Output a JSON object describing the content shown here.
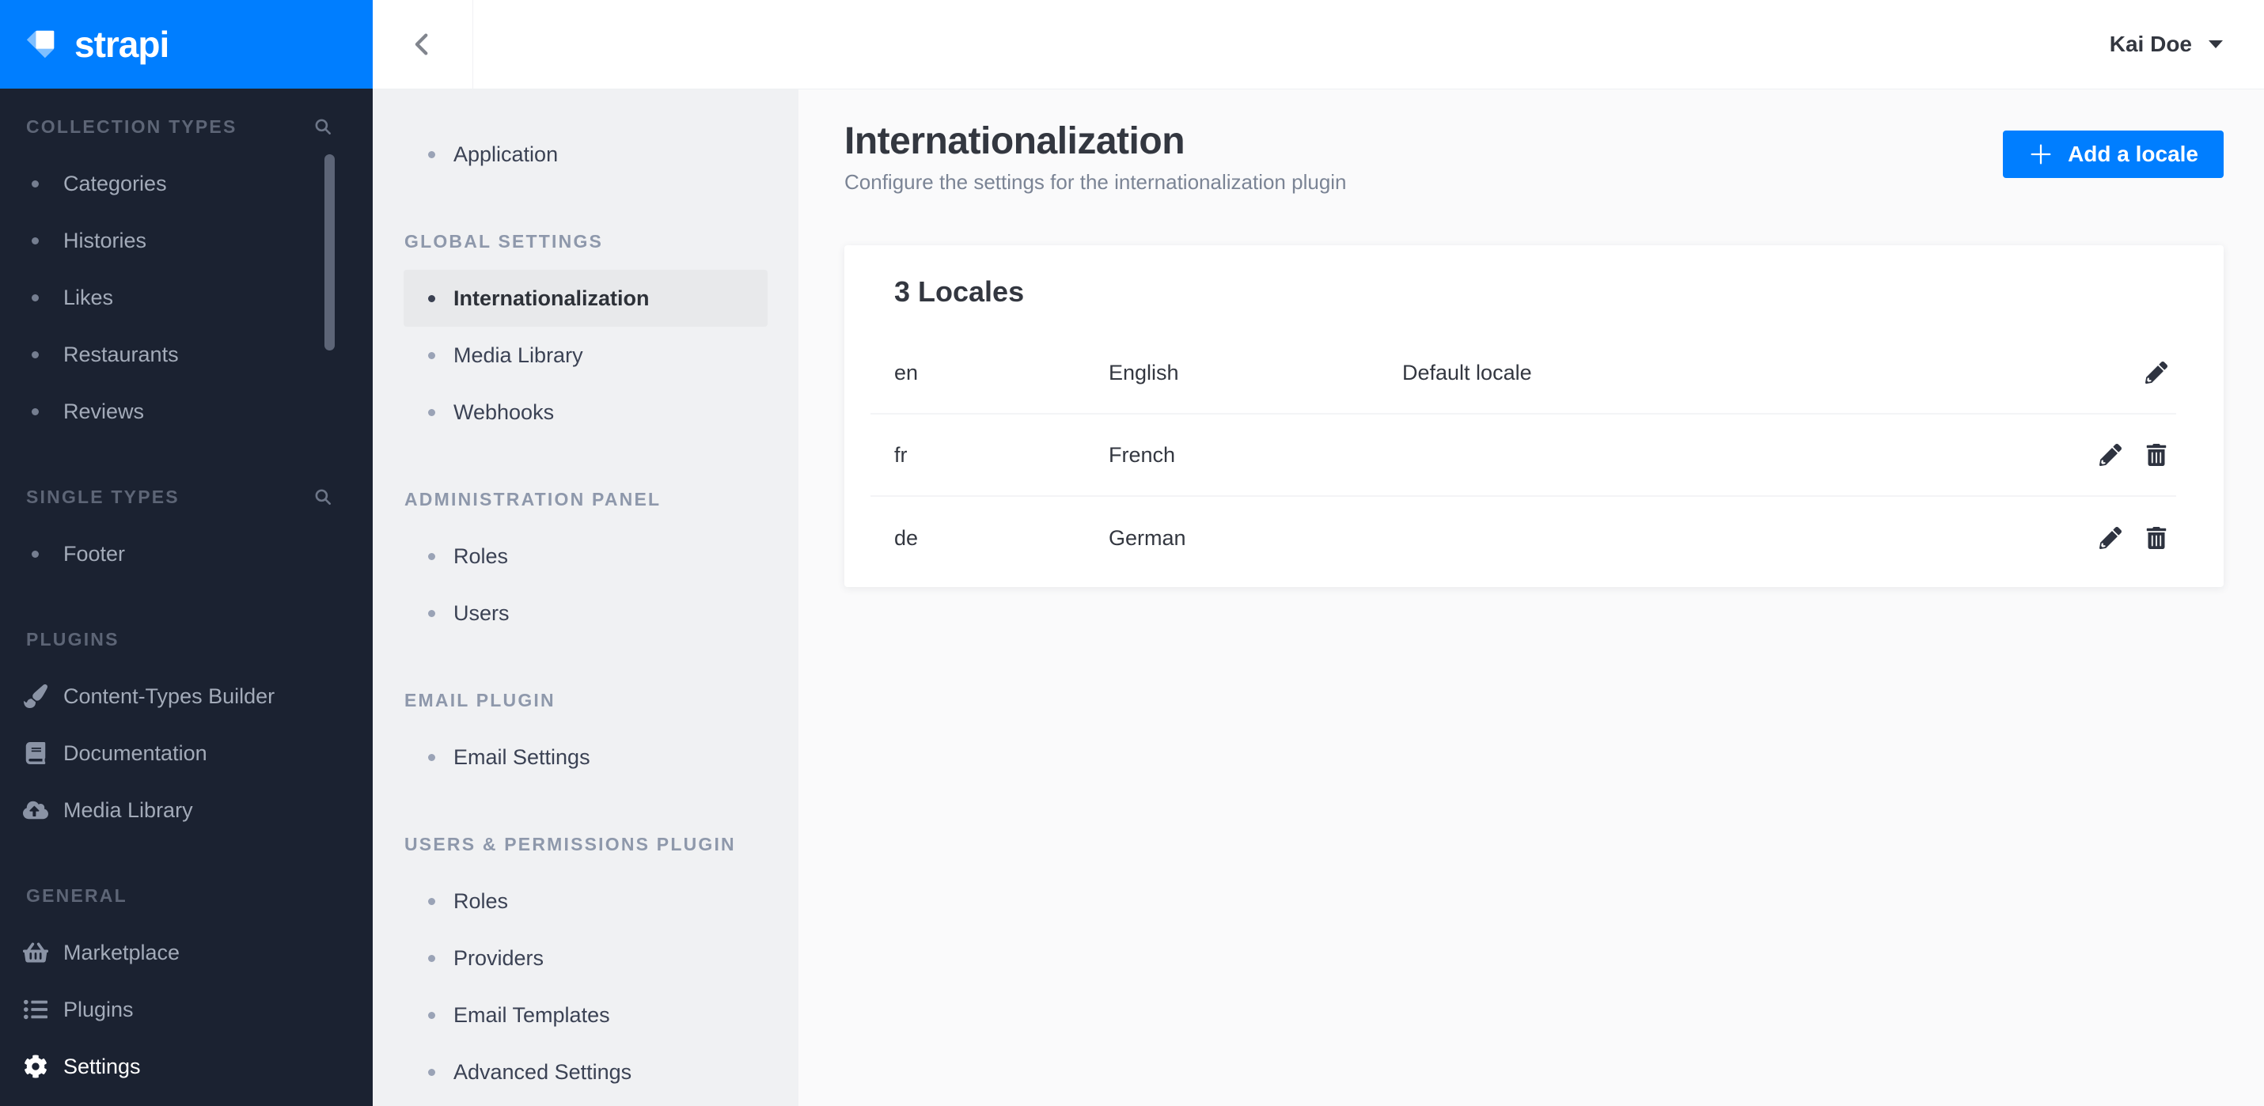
{
  "brand": {
    "name": "strapi"
  },
  "colors": {
    "accent_blue": "#007eff",
    "dark_sidebar_bg": "#1b2231",
    "sub_sidebar_bg": "#f0f1f3",
    "active_item_bg": "#e8e9eb",
    "main_bg": "#fafafb",
    "text_dark": "#333740",
    "text_muted": "#7b8495"
  },
  "topbar": {
    "user_name": "Kai Doe"
  },
  "dark_sidebar": {
    "sections": [
      {
        "label": "COLLECTION TYPES",
        "has_search": true,
        "items": [
          {
            "label": "Categories"
          },
          {
            "label": "Histories"
          },
          {
            "label": "Likes"
          },
          {
            "label": "Restaurants"
          },
          {
            "label": "Reviews"
          }
        ]
      },
      {
        "label": "SINGLE TYPES",
        "has_search": true,
        "items": [
          {
            "label": "Footer"
          }
        ]
      },
      {
        "label": "PLUGINS",
        "items": [
          {
            "label": "Content-Types Builder",
            "icon": "paintbrush-icon"
          },
          {
            "label": "Documentation",
            "icon": "book-icon"
          },
          {
            "label": "Media Library",
            "icon": "cloud-upload-icon"
          }
        ]
      },
      {
        "label": "GENERAL",
        "items": [
          {
            "label": "Marketplace",
            "icon": "basket-icon"
          },
          {
            "label": "Plugins",
            "icon": "list-icon"
          },
          {
            "label": "Settings",
            "icon": "gear-icon",
            "active": true
          }
        ]
      }
    ]
  },
  "settings_sidebar": {
    "top_items": [
      {
        "label": "Application"
      }
    ],
    "sections": [
      {
        "label": "GLOBAL SETTINGS",
        "items": [
          {
            "label": "Internationalization",
            "active": true
          },
          {
            "label": "Media Library"
          },
          {
            "label": "Webhooks"
          }
        ]
      },
      {
        "label": "ADMINISTRATION PANEL",
        "items": [
          {
            "label": "Roles"
          },
          {
            "label": "Users"
          }
        ]
      },
      {
        "label": "EMAIL PLUGIN",
        "items": [
          {
            "label": "Email Settings"
          }
        ]
      },
      {
        "label": "USERS & PERMISSIONS PLUGIN",
        "items": [
          {
            "label": "Roles"
          },
          {
            "label": "Providers"
          },
          {
            "label": "Email Templates"
          },
          {
            "label": "Advanced Settings"
          }
        ]
      }
    ]
  },
  "main": {
    "title": "Internationalization",
    "subtitle": "Configure the settings for the internationalization plugin",
    "add_button_label": "Add a locale",
    "card": {
      "title": "3 Locales",
      "rows": [
        {
          "code": "en",
          "name": "English",
          "note": "Default locale"
        },
        {
          "code": "fr",
          "name": "French",
          "note": ""
        },
        {
          "code": "de",
          "name": "German",
          "note": ""
        }
      ]
    }
  }
}
